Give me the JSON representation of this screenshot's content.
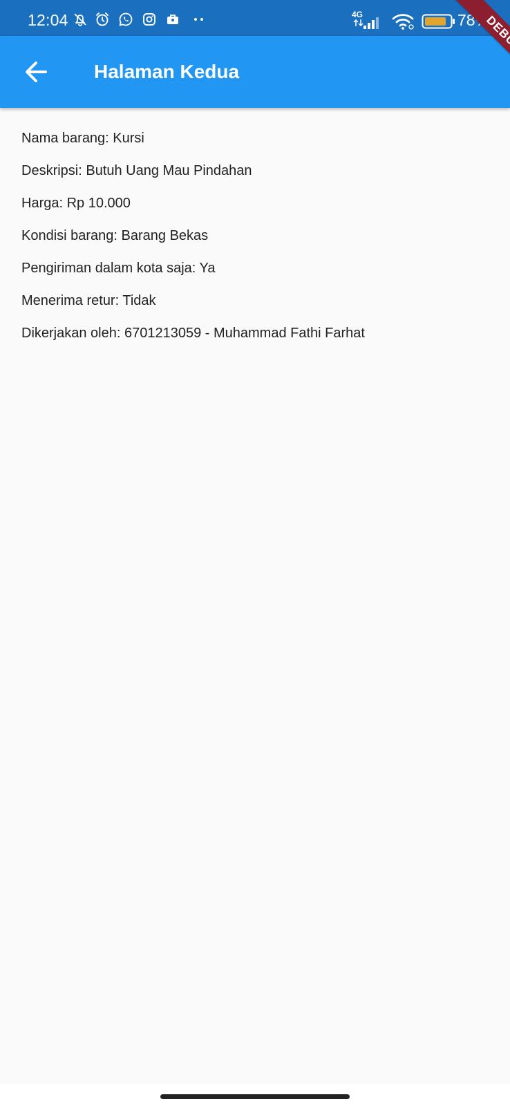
{
  "status_bar": {
    "time": "12:04",
    "network": "4G",
    "battery": "78%",
    "icons": [
      "notifications-off-icon",
      "alarm-icon",
      "whatsapp-icon",
      "instagram-icon",
      "work-bag-icon",
      "more-dots-icon",
      "signal-icon",
      "wifi-icon",
      "battery-icon"
    ]
  },
  "app_bar": {
    "title": "Halaman Kedua",
    "back_icon": "arrow-back-icon",
    "background": "#2196f3"
  },
  "debug_banner": {
    "label": "DEBUG"
  },
  "details": [
    "Nama barang: Kursi",
    "Deskripsi: Butuh Uang Mau Pindahan",
    "Harga: Rp 10.000",
    "Kondisi barang: Barang Bekas",
    "Pengiriman dalam kota saja: Ya",
    "Menerima retur: Tidak",
    "Dikerjakan oleh: 6701213059 - Muhammad Fathi Farhat"
  ]
}
